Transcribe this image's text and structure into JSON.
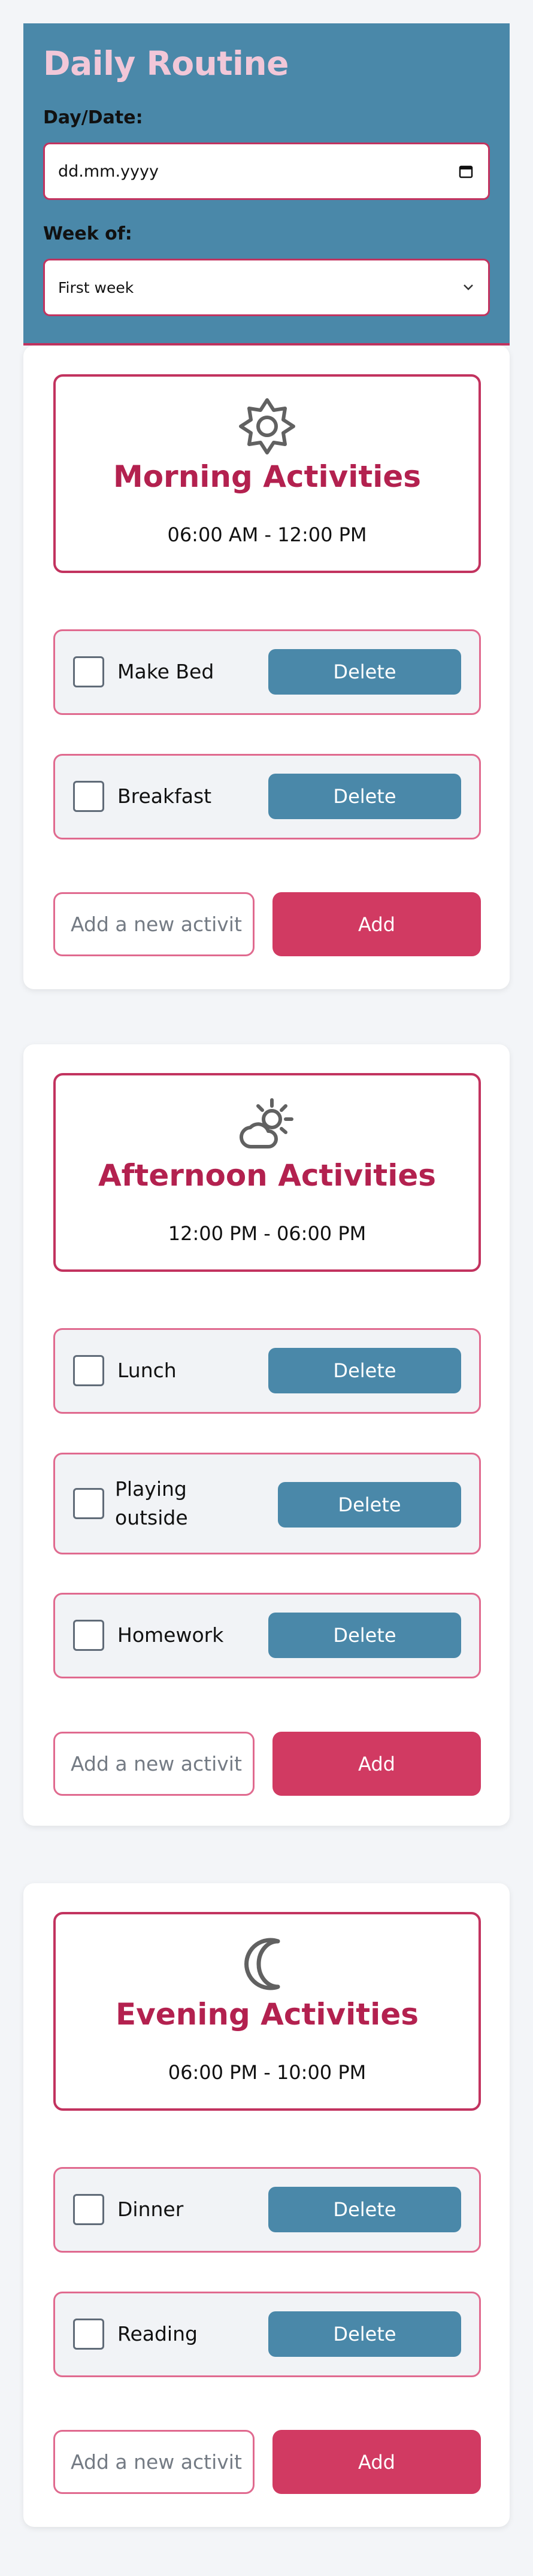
{
  "header": {
    "title": "Daily Routine",
    "date_label": "Day/Date:",
    "date_placeholder": "dd.mm.yyyy",
    "week_label": "Week of:",
    "week_selected": "First week"
  },
  "colors": {
    "header_bg": "#4a88a9",
    "accent": "#c2335f",
    "title_pink": "#f1c7d8",
    "section_title": "#b3214f",
    "delete_button": "#4a88a9",
    "add_button": "#d13a62"
  },
  "sections": [
    {
      "icon": "sun-icon",
      "title": "Morning Activities",
      "time": "06:00 AM - 12:00 PM",
      "activities": [
        {
          "label": "Make Bed",
          "checked": false,
          "delete_label": "Delete"
        },
        {
          "label": "Breakfast",
          "checked": false,
          "delete_label": "Delete"
        }
      ],
      "add_placeholder": "Add a new activit",
      "add_label": "Add"
    },
    {
      "icon": "sun-cloud-icon",
      "title": "Afternoon Activities",
      "time": "12:00 PM - 06:00 PM",
      "activities": [
        {
          "label": "Lunch",
          "checked": false,
          "delete_label": "Delete"
        },
        {
          "label_line1": "Playing",
          "label_line2": "outside",
          "checked": false,
          "delete_label": "Delete"
        },
        {
          "label": "Homework",
          "checked": false,
          "delete_label": "Delete"
        }
      ],
      "add_placeholder": "Add a new activit",
      "add_label": "Add"
    },
    {
      "icon": "moon-icon",
      "title": "Evening Activities",
      "time": "06:00 PM - 10:00 PM",
      "activities": [
        {
          "label": "Dinner",
          "checked": false,
          "delete_label": "Delete"
        },
        {
          "label": "Reading",
          "checked": false,
          "delete_label": "Delete"
        }
      ],
      "add_placeholder": "Add a new activit",
      "add_label": "Add"
    }
  ]
}
